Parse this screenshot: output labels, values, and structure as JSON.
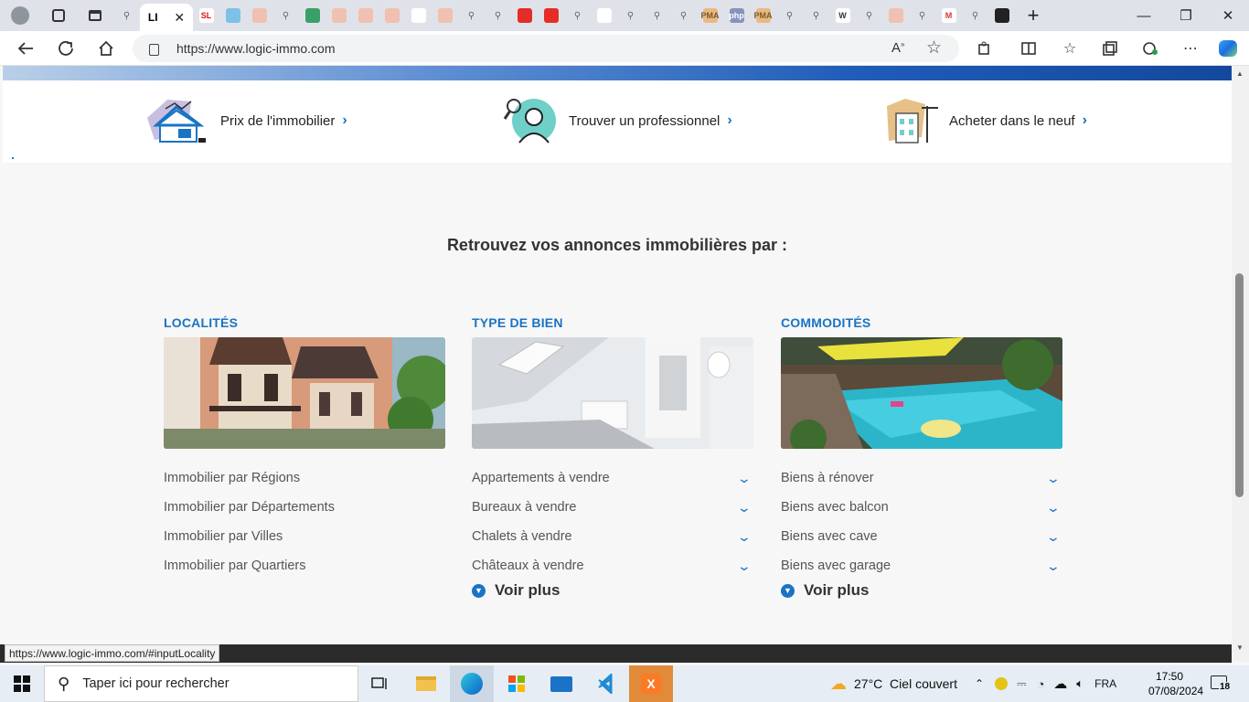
{
  "browser": {
    "url": "https://www.logic-immo.com",
    "active_tab_label": "LI",
    "tabs": [
      {
        "icon": "search-tab-icon",
        "label": ""
      },
      {
        "icon": "sl-tab-icon",
        "label": "SL"
      },
      {
        "icon": "edge-tab-icon",
        "label": ""
      },
      {
        "icon": "tab-icon",
        "label": ""
      },
      {
        "icon": "search-tab-icon",
        "label": ""
      },
      {
        "icon": "globe-tab-icon",
        "label": ""
      },
      {
        "icon": "tab-icon",
        "label": ""
      },
      {
        "icon": "tab-icon",
        "label": ""
      },
      {
        "icon": "tab-icon",
        "label": ""
      },
      {
        "icon": "pdf-tab-icon",
        "label": ""
      },
      {
        "icon": "tab-icon",
        "label": ""
      },
      {
        "icon": "search-tab-icon",
        "label": ""
      },
      {
        "icon": "search-tab-icon",
        "label": ""
      },
      {
        "icon": "youtube-tab-icon",
        "label": ""
      },
      {
        "icon": "youtube-tab-icon",
        "label": ""
      },
      {
        "icon": "search-tab-icon",
        "label": ""
      },
      {
        "icon": "doc-tab-icon",
        "label": ""
      },
      {
        "icon": "search-tab-icon",
        "label": ""
      },
      {
        "icon": "search-tab-icon",
        "label": ""
      },
      {
        "icon": "search-tab-icon",
        "label": ""
      },
      {
        "icon": "pma-tab-icon",
        "label": "PMA"
      },
      {
        "icon": "php-tab-icon",
        "label": "php"
      },
      {
        "icon": "pma-tab-icon",
        "label": "PMA"
      },
      {
        "icon": "search-tab-icon",
        "label": ""
      },
      {
        "icon": "search-tab-icon",
        "label": ""
      },
      {
        "icon": "wikipedia-tab-icon",
        "label": "W"
      },
      {
        "icon": "search-tab-icon",
        "label": ""
      },
      {
        "icon": "tab-icon",
        "label": ""
      },
      {
        "icon": "search-tab-icon",
        "label": ""
      },
      {
        "icon": "gmail-tab-icon",
        "label": "M"
      },
      {
        "icon": "search-tab-icon",
        "label": ""
      },
      {
        "icon": "github-tab-icon",
        "label": ""
      }
    ]
  },
  "quick_links": [
    {
      "label": "Prix de l'immobilier"
    },
    {
      "label": "Trouver un professionnel"
    },
    {
      "label": "Acheter dans le neuf"
    }
  ],
  "section_title": "Retrouvez vos annonces immobilières par :",
  "columns": [
    {
      "title": "LOCALITÉS",
      "items": [
        "Immobilier par Régions",
        "Immobilier par Départements",
        "Immobilier par Villes",
        "Immobilier par Quartiers"
      ],
      "more": ""
    },
    {
      "title": "TYPE DE BIEN",
      "items": [
        "Appartements à vendre",
        "Bureaux à vendre",
        "Chalets à vendre",
        "Châteaux à vendre"
      ],
      "more": "Voir plus"
    },
    {
      "title": "COMMODITÉS",
      "items": [
        "Biens à rénover",
        "Biens avec balcon",
        "Biens avec cave",
        "Biens avec garage"
      ],
      "more": "Voir plus"
    }
  ],
  "status_url": "https://www.logic-immo.com/#inputLocality",
  "taskbar": {
    "search_placeholder": "Taper ici pour rechercher",
    "weather": "27°C  Ciel couvert",
    "lang": "FRA",
    "time": "17:50",
    "date": "07/08/2024",
    "notif_count": "18"
  },
  "colors": {
    "accent": "#1a73c4",
    "hero": "#1f5cb8"
  }
}
